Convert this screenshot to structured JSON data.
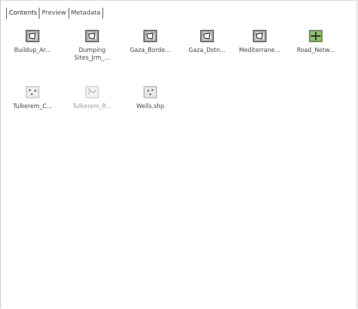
{
  "tabs": [
    {
      "label": "Contents"
    },
    {
      "label": "Preview"
    },
    {
      "label": "Metadata"
    }
  ],
  "items": [
    {
      "label": "Buildup_Ar...",
      "label2": "",
      "icon": "polygon-shapefile-icon"
    },
    {
      "label": "Dumping",
      "label2": "Sites_Jrm_...",
      "icon": "polygon-shapefile-icon"
    },
    {
      "label": "Gaza_Borde...",
      "label2": "",
      "icon": "polygon-shapefile-icon"
    },
    {
      "label": "Gaza_Dstn...",
      "label2": "",
      "icon": "polygon-shapefile-icon"
    },
    {
      "label": "Mediterrane...",
      "label2": "",
      "icon": "polygon-shapefile-icon"
    },
    {
      "label": "Road_Netw...",
      "label2": "",
      "icon": "line-shapefile-icon"
    },
    {
      "label": "Tulkerem_C...",
      "label2": "",
      "icon": "point-shapefile-icon"
    },
    {
      "label": "Tulkerem_R...",
      "label2": "",
      "icon": "point-shapefile-icon"
    },
    {
      "label": "Wells.shp",
      "label2": "",
      "icon": "point-shapefile-icon"
    }
  ]
}
